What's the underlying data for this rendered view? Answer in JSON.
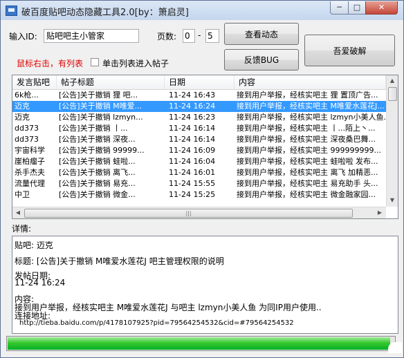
{
  "window": {
    "title": "破百度贴吧动态隐藏工具2.0[by：箫启灵]",
    "min_glyph": "─",
    "max_glyph": "□",
    "close_glyph": "✕"
  },
  "form": {
    "id_label": "输入ID:",
    "id_value": "贴吧吧主小管家",
    "pages_label": "页数:",
    "page_from": "0",
    "page_sep": "-",
    "page_to": "5",
    "view_button": "查看动态",
    "feedback_button": "反馈BUG",
    "crack_button": "吾爱破解",
    "hint": "鼠标右击，有列表",
    "checkbox_label": "单击列表进入帖子"
  },
  "list": {
    "columns": [
      "发言贴吧",
      "帖子标题",
      "日期",
      "内容"
    ],
    "rows": [
      {
        "forum": "6k枪...",
        "title": "[公告]关于撤销 狸 吧...",
        "date": "11-24 16:43",
        "content": "接到用户举报，经核实吧主 狸 置顶广告..."
      },
      {
        "forum": "迈克",
        "title": "[公告]关于撤销 M唯爱...",
        "date": "11-24 16:24",
        "content": "接到用户举报，经核实吧主 M唯爱水莲花J..."
      },
      {
        "forum": "迈克",
        "title": "[公告]关于撤销 lzmyn...",
        "date": "11-24 16:23",
        "content": "接到用户举报，经核实吧主 lzmyn小美人鱼..."
      },
      {
        "forum": "dd373",
        "title": "[公告]关于撤销 丨...",
        "date": "11-24 16:14",
        "content": "接到用户举报，经核实吧主 丨...陌上丶..."
      },
      {
        "forum": "dd373",
        "title": "[公告]关于撤销 深夜...",
        "date": "11-24 16:14",
        "content": "接到用户举报，经核实吧主 深夜桑巴舞..."
      },
      {
        "forum": "宇宙科学",
        "title": "[公告]关于撤销 99999...",
        "date": "11-24 16:09",
        "content": "接到用户举报，经核实吧主 999999999..."
      },
      {
        "forum": "崖柏瘤子",
        "title": "[公告]关于撤销 蛙啦...",
        "date": "11-24 16:04",
        "content": "接到用户举报，经核实吧主 蛙啦啦 发布..."
      },
      {
        "forum": "杀手杰夫",
        "title": "[公告]关于撤销 离飞...",
        "date": "11-24 16:01",
        "content": "接到用户举报，经核实吧主 离飞 加精恶..."
      },
      {
        "forum": "流量代理",
        "title": "[公告]关于撤销 易充...",
        "date": "11-24 15:55",
        "content": "接到用户举报，经核实吧主 易充助手 头..."
      },
      {
        "forum": "中卫",
        "title": "[公告]关于撤销 微金...",
        "date": "11-24 15:25",
        "content": "接到用户举报，经核实吧主 微金融家园..."
      }
    ],
    "selected_index": 1
  },
  "detail": {
    "label": "详情:",
    "forum_line": "贴吧: 迈克",
    "title_line": "标题: [公告]关于撤销 M唯爱水莲花J 吧主管理权限的说明",
    "date_label": "发帖日期:",
    "date_value": "11-24 16:24",
    "content_label": "内容:",
    "content_value": "接到用户举报，经核实吧主 M唯爱水莲花J 与吧主 lzmyn小美人鱼 为同IP用户使用..",
    "link_label": "连接地址:",
    "link_value": "http://tieba.baidu.com/p/4178107925?pid=79564254532&cid=#79564254532"
  },
  "progress": {
    "value": 0.99
  },
  "colors": {
    "selection": "#3399ff",
    "hint_red": "#e00000",
    "progress_green": "#06b025"
  }
}
